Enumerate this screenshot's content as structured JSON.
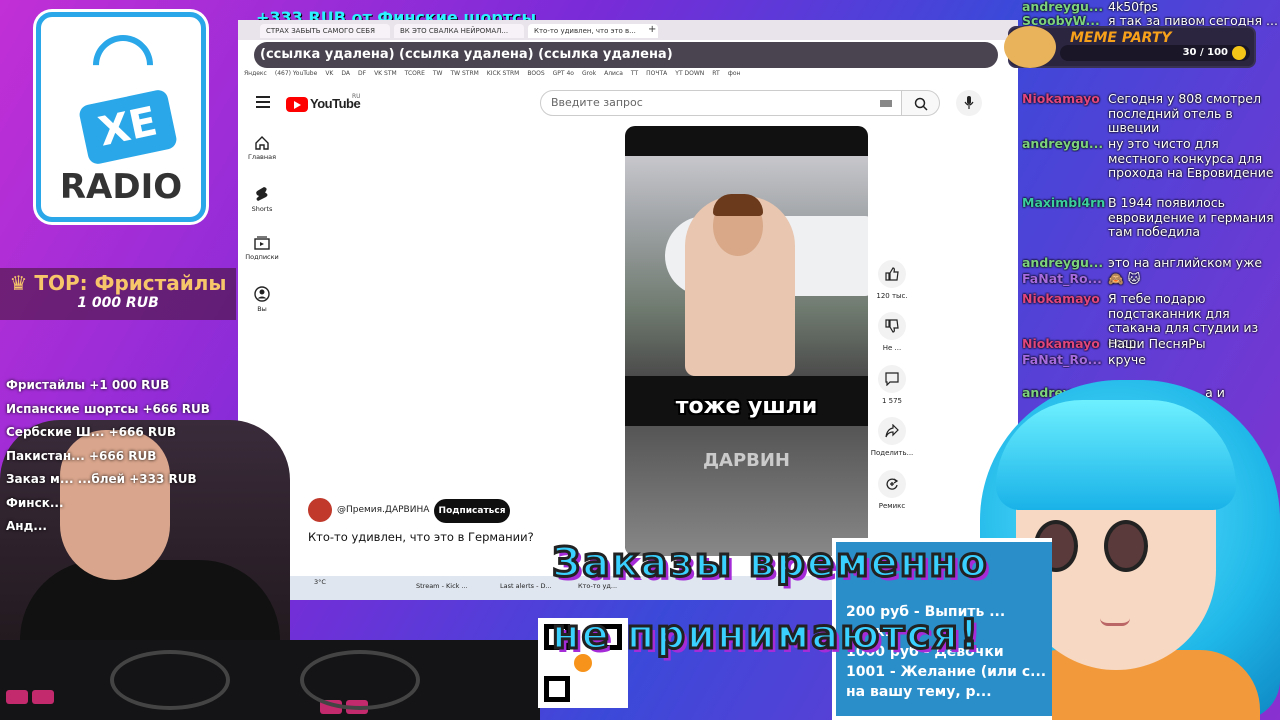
{
  "overlay": {
    "logo_xe": "XE",
    "logo_radio": "RADIO",
    "top_title": "♛ TOP: Фристайлы",
    "top_amount": "1 000 RUB",
    "top_banner": "+333 RUB   от Финские шортсы",
    "donations": [
      "Фристайлы +1 000 RUB",
      "Испанские шортсы +666 RUB",
      "Сербские Ш... +666 RUB",
      "Пакистан... +666 RUB",
      "Заказ м... ...блей +333 RUB",
      "Финск...",
      "Анд..."
    ],
    "big_text_1": "Заказы временно",
    "big_text_2": "не принимаются!",
    "orders": [
      "200 руб - Выпить ...",
      "... ск...",
      "1000 руб - Девочки",
      "1001 - Желание (или с...",
      "на вашу тему, р..."
    ],
    "meme_title": "MEME PARTY",
    "meme_progress": "30 / 100",
    "meme_progress_fraction": 0.3
  },
  "browser": {
    "tabs": [
      "СТРАХ ЗАБЫТЬ САМОГО СЕБЯ",
      "ВК ЭТО СВАЛКА НЕЙРОМАЛ...",
      "Кто-то удивлен, что это в..."
    ],
    "address": "(ссылка удалена) (ссылка удалена) (ссылка удалена)",
    "bookmarks": [
      "Яндекс",
      "(467) YouTube",
      "VK",
      "DA",
      "DF",
      "VK STM",
      "TCORE",
      "TW",
      "TW STRM",
      "KICK STRM",
      "BOOS",
      "GPT 4o",
      "Grok",
      "Алиса",
      "TT",
      "ПОЧТА",
      "YT DOWN",
      "RT",
      "фон"
    ],
    "taskbar": [
      "Stream - Kick ...",
      "Last alerts - D...",
      "Кто-то уд..."
    ],
    "weather": "3°C"
  },
  "youtube": {
    "logo_text": "YouTube",
    "region": "RU",
    "search_placeholder": "Введите запрос",
    "nav": [
      "Главная",
      "Shorts",
      "Подписки",
      "Вы"
    ],
    "caption_1": "тоже ушли",
    "caption_2": "ДАРВИН",
    "actions": {
      "likes": "120 тыс.",
      "dislike": "Не ...",
      "comments": "1 575",
      "share": "Поделить...",
      "remix": "Ремикс"
    },
    "channel": "@Премия.ДАРВИНА",
    "subscribe": "Подписаться",
    "title": "Кто-то удивлен, что это в Германии?"
  },
  "chat": [
    {
      "user": "andreygu...",
      "text": "4k50fps"
    },
    {
      "user": "ScoobyW...",
      "text": "я так за пивом сегодня ... один в один"
    },
    {
      "user": "Niokamayo",
      "text": "Сегодня у 808 смотрел последний отель в швеции"
    },
    {
      "user": "andreygu...",
      "text": "ну это чисто для местного конкурса для прохода на Евровидение"
    },
    {
      "user": "Maximbl4rn",
      "text": "В 1944 появилось евровидение и германия там победила"
    },
    {
      "user": "andreygu...",
      "text": "это на английском уже"
    },
    {
      "user": "FaNat_Ro...",
      "text": "🙈 🐱"
    },
    {
      "user": "Niokamayo",
      "text": "Я тебе подарю подстаканник для стакана для студии из ссср"
    },
    {
      "user": "Niokamayo",
      "text": "Наши ПесняРы"
    },
    {
      "user": "FaNat_Ro...",
      "text": "круче"
    },
    {
      "user": "andreygu...",
      "text": "...ти 4k50fps ...а и"
    }
  ]
}
